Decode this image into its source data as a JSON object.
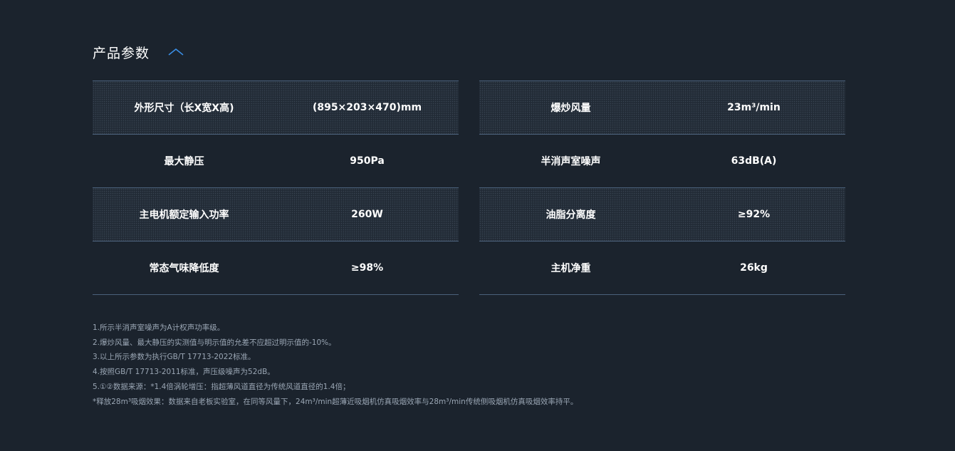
{
  "section": {
    "title": "产品参数",
    "collapse_icon": "chevron-up-icon",
    "accent_color": "#3a8ee6"
  },
  "table_left": [
    {
      "label": "外形尺寸（长X宽X高)",
      "value": "(895×203×470)mm",
      "shaded": true
    },
    {
      "label": "最大静压",
      "value": "950Pa",
      "shaded": false
    },
    {
      "label": "主电机额定输入功率",
      "value": "260W",
      "shaded": true
    },
    {
      "label": "常态气味降低度",
      "value": "≥98%",
      "shaded": false
    }
  ],
  "table_right": [
    {
      "label": "爆炒风量",
      "value": "23m³/min",
      "shaded": true
    },
    {
      "label": "半消声室噪声",
      "value": "63dB(A)",
      "shaded": false
    },
    {
      "label": "油脂分离度",
      "value": "≥92%",
      "shaded": true
    },
    {
      "label": "主机净重",
      "value": "26kg",
      "shaded": false
    }
  ],
  "notes": [
    "1.所示半消声室噪声为A计权声功率级。",
    "2.爆炒风量、最大静压的实测值与明示值的允差不应超过明示值的-10%。",
    "3.以上所示参数为执行GB/T 17713-2022标准。",
    "4.按照GB/T 17713-2011标准，声压级噪声为52dB。",
    "5.①②数据来源：*1.4倍涡轮增压：指超薄风道直径为传统风道直径的1.4倍；",
    "*释放28m³吸烟效果：数据来自老板实验室，在同等风量下，24m³/min超薄近吸烟机仿真吸烟效率与28m³/min传统侧吸烟机仿真吸烟效率持平。"
  ]
}
